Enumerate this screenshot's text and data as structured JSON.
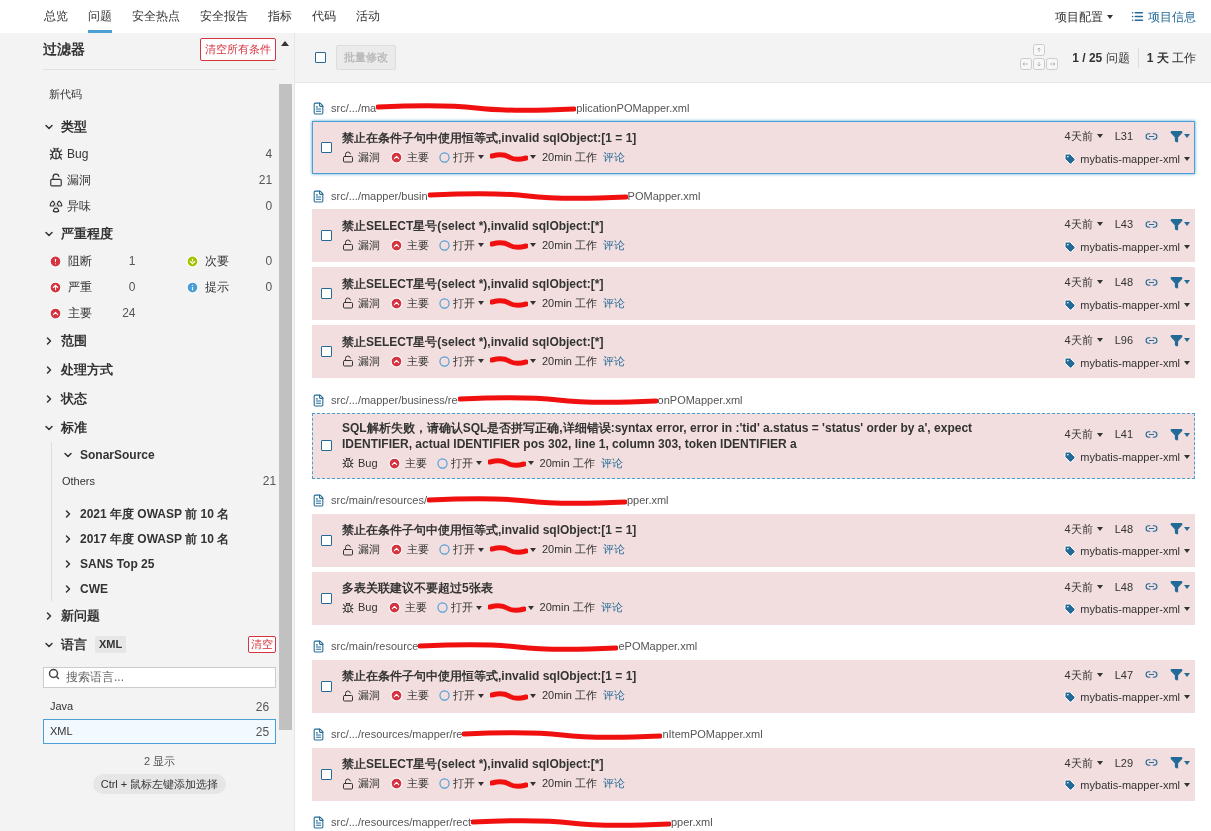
{
  "nav": {
    "tabs": [
      {
        "label": "总览",
        "selected": false
      },
      {
        "label": "问题",
        "selected": true
      },
      {
        "label": "安全热点",
        "selected": false
      },
      {
        "label": "安全报告",
        "selected": false
      },
      {
        "label": "指标",
        "selected": false
      },
      {
        "label": "代码",
        "selected": false
      },
      {
        "label": "活动",
        "selected": false
      }
    ],
    "config": "项目配置",
    "info": "项目信息"
  },
  "sidebar": {
    "title": "过滤器",
    "clear_all": "清空所有条件",
    "new_code": "新代码",
    "facets": [
      {
        "kind": "type",
        "label": "类型",
        "expanded": true,
        "items": [
          {
            "kind": "bug",
            "label": "Bug",
            "count": "4"
          },
          {
            "kind": "vulnerability",
            "label": "漏洞",
            "count": "21"
          },
          {
            "kind": "code_smell",
            "label": "异味",
            "count": "0"
          }
        ]
      },
      {
        "kind": "severity",
        "label": "严重程度",
        "expanded": true,
        "items": [
          {
            "kind": "blocker",
            "label": "阻断",
            "count": "1"
          },
          {
            "kind": "minor",
            "label": "次要",
            "count": "0"
          },
          {
            "kind": "critical",
            "label": "严重",
            "count": "0"
          },
          {
            "kind": "info",
            "label": "提示",
            "count": "0"
          },
          {
            "kind": "major",
            "label": "主要",
            "count": "24"
          }
        ]
      },
      {
        "kind": "plain",
        "label": "范围",
        "expanded": false
      },
      {
        "kind": "plain",
        "label": "处理方式",
        "expanded": false
      },
      {
        "kind": "plain",
        "label": "状态",
        "expanded": false
      },
      {
        "kind": "tree",
        "label": "标准",
        "expanded": true,
        "children": [
          {
            "label": "SonarSource",
            "expanded": true,
            "items": [
              {
                "label": "Others",
                "count": "21"
              }
            ]
          },
          {
            "label": "2021 年度 OWASP 前 10 名",
            "expanded": false
          },
          {
            "label": "2017 年度 OWASP 前 10 名",
            "expanded": false
          },
          {
            "label": "SANS Top 25",
            "expanded": false
          },
          {
            "label": "CWE",
            "expanded": false
          }
        ]
      },
      {
        "kind": "plain",
        "label": "新问题",
        "expanded": false
      },
      {
        "kind": "language",
        "label": "语言",
        "expanded": true,
        "badge": "XML",
        "clear": "清空",
        "search": {
          "placeholder": "搜索语言..."
        },
        "items": [
          {
            "label": "Java",
            "count": "26",
            "selected": false
          },
          {
            "label": "XML",
            "count": "25",
            "selected": true
          }
        ],
        "shown": "2 显示",
        "hint": "Ctrl + 鼠标左键添加选择"
      }
    ]
  },
  "toolbar": {
    "checked": false,
    "bulk": "批量修改",
    "count": "**1 / 25** 问题",
    "effort": "**1 天** 工作"
  },
  "groups": [
    {
      "path_start": "src/.../ma",
      "path_end": "plicationPOMapper.xml",
      "issues": [
        {
          "checked": false,
          "selected": true,
          "focused": false,
          "message": "禁止在条件子句中使用恒等式,invalid sqlObject:[1 = 1]",
          "type": {
            "kind": "vulnerability",
            "label": "漏洞"
          },
          "severity": {
            "kind": "major",
            "label": "主要"
          },
          "status": "打开",
          "effort": "20min 工作",
          "comment": "评论",
          "age": "4天前",
          "line": "L31",
          "tag": "mybatis-mapper-xml"
        }
      ]
    },
    {
      "path_start": "src/.../mapper/busin",
      "path_end": "POMapper.xml",
      "issues": [
        {
          "checked": false,
          "selected": false,
          "focused": false,
          "message": "禁止SELECT星号(select *),invalid sqlObject:[*]",
          "type": {
            "kind": "vulnerability",
            "label": "漏洞"
          },
          "severity": {
            "kind": "major",
            "label": "主要"
          },
          "status": "打开",
          "effort": "20min 工作",
          "comment": "评论",
          "age": "4天前",
          "line": "L43",
          "tag": "mybatis-mapper-xml"
        },
        {
          "checked": false,
          "selected": false,
          "focused": false,
          "message": "禁止SELECT星号(select *),invalid sqlObject:[*]",
          "type": {
            "kind": "vulnerability",
            "label": "漏洞"
          },
          "severity": {
            "kind": "major",
            "label": "主要"
          },
          "status": "打开",
          "effort": "20min 工作",
          "comment": "评论",
          "age": "4天前",
          "line": "L48",
          "tag": "mybatis-mapper-xml"
        },
        {
          "checked": false,
          "selected": false,
          "focused": false,
          "message": "禁止SELECT星号(select *),invalid sqlObject:[*]",
          "type": {
            "kind": "vulnerability",
            "label": "漏洞"
          },
          "severity": {
            "kind": "major",
            "label": "主要"
          },
          "status": "打开",
          "effort": "20min 工作",
          "comment": "评论",
          "age": "4天前",
          "line": "L96",
          "tag": "mybatis-mapper-xml"
        }
      ]
    },
    {
      "path_start": "src/.../mapper/business/re",
      "path_end": "onPOMapper.xml",
      "issues": [
        {
          "checked": false,
          "selected": false,
          "focused": true,
          "message": "SQL解析失败，请确认SQL是否拼写正确,详细错误:syntax error, error in :'tid' a.status = 'status' order by a', expect IDENTIFIER, actual IDENTIFIER pos 302, line 1, column 303, token IDENTIFIER a",
          "type": {
            "kind": "bug",
            "label": "Bug"
          },
          "severity": {
            "kind": "major",
            "label": "主要"
          },
          "status": "打开",
          "effort": "20min 工作",
          "comment": "评论",
          "age": "4天前",
          "line": "L41",
          "tag": "mybatis-mapper-xml"
        }
      ]
    },
    {
      "path_start": "src/main/resources/",
      "path_end": "pper.xml",
      "issues": [
        {
          "checked": false,
          "selected": false,
          "focused": false,
          "message": "禁止在条件子句中使用恒等式,invalid sqlObject:[1 = 1]",
          "type": {
            "kind": "vulnerability",
            "label": "漏洞"
          },
          "severity": {
            "kind": "major",
            "label": "主要"
          },
          "status": "打开",
          "effort": "20min 工作",
          "comment": "评论",
          "age": "4天前",
          "line": "L48",
          "tag": "mybatis-mapper-xml"
        },
        {
          "checked": false,
          "selected": false,
          "focused": false,
          "message": "多表关联建议不要超过5张表",
          "type": {
            "kind": "bug",
            "label": "Bug"
          },
          "severity": {
            "kind": "major",
            "label": "主要"
          },
          "status": "打开",
          "effort": "20min 工作",
          "comment": "评论",
          "age": "4天前",
          "line": "L48",
          "tag": "mybatis-mapper-xml"
        }
      ]
    },
    {
      "path_start": "src/main/resource",
      "path_end": "ePOMapper.xml",
      "issues": [
        {
          "checked": false,
          "selected": false,
          "focused": false,
          "message": "禁止在条件子句中使用恒等式,invalid sqlObject:[1 = 1]",
          "type": {
            "kind": "vulnerability",
            "label": "漏洞"
          },
          "severity": {
            "kind": "major",
            "label": "主要"
          },
          "status": "打开",
          "effort": "20min 工作",
          "comment": "评论",
          "age": "4天前",
          "line": "L47",
          "tag": "mybatis-mapper-xml"
        }
      ]
    },
    {
      "path_start": "src/.../resources/mapper/re",
      "path_end": "nItemPOMapper.xml",
      "issues": [
        {
          "checked": false,
          "selected": false,
          "focused": false,
          "message": "禁止SELECT星号(select *),invalid sqlObject:[*]",
          "type": {
            "kind": "vulnerability",
            "label": "漏洞"
          },
          "severity": {
            "kind": "major",
            "label": "主要"
          },
          "status": "打开",
          "effort": "20min 工作",
          "comment": "评论",
          "age": "4天前",
          "line": "L29",
          "tag": "mybatis-mapper-xml"
        }
      ]
    },
    {
      "path_start": "src/.../resources/mapper/rect",
      "path_end": "pper.xml"
    }
  ]
}
